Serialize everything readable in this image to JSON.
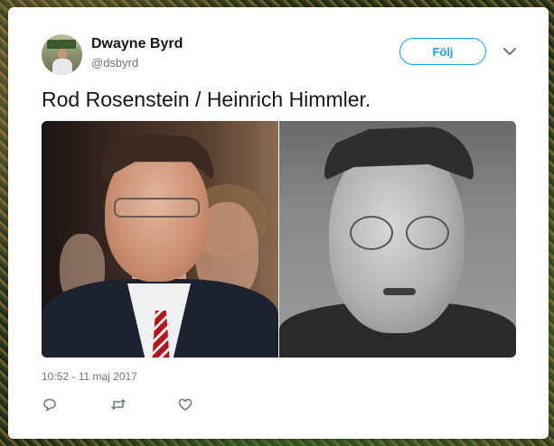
{
  "tweet": {
    "user": {
      "name": "Dwayne Byrd",
      "handle": "@dsbyrd"
    },
    "follow_label": "Följ",
    "text": "Rod Rosenstein / Heinrich Himmler.",
    "timestamp": "10:52 - 11 maj 2017",
    "media": [
      {
        "subject": "left-photo"
      },
      {
        "subject": "right-photo"
      }
    ],
    "actions": {
      "reply_icon": "reply-icon",
      "retweet_icon": "retweet-icon",
      "like_icon": "heart-icon"
    }
  },
  "colors": {
    "accent": "#1da1f2",
    "text": "#14171a",
    "secondary": "#657786",
    "card": "#ffffff"
  }
}
